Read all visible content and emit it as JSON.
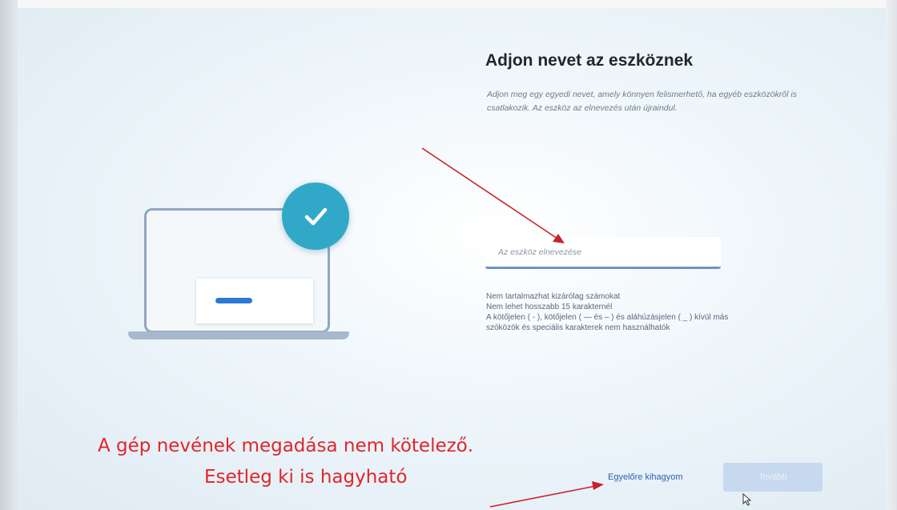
{
  "setup": {
    "title": "Adjon nevet az eszköznek",
    "subtitle": "Adjon meg egy egyedi nevet, amely könnyen felismerhető, ha egyéb eszközökről is csatlakozik. Az eszköz az elnevezés után újraindul.",
    "name_input": {
      "value": "",
      "placeholder": "Az eszköz elnevezése"
    },
    "rules": [
      "Nem tartalmazhat kizárólag számokat",
      "Nem lehet hosszabb 15 karakternél",
      "A kötőjelen ( - ), kötőjelen ( — és – ) és aláhúzásjelen ( _ ) kívül más",
      "szóközök és speciális karakterek nem használhatók"
    ],
    "skip_label": "Egyelőre kihagyom",
    "next_label": "Tovább"
  },
  "annotation": {
    "line1": "A gép nevének megadása nem kötelező.",
    "line2": "Esetleg ki is hagyható",
    "color": "#e0262a"
  },
  "colors": {
    "accent": "#2a78d4",
    "badge": "#31a8c8",
    "link": "#2f5fb0"
  }
}
